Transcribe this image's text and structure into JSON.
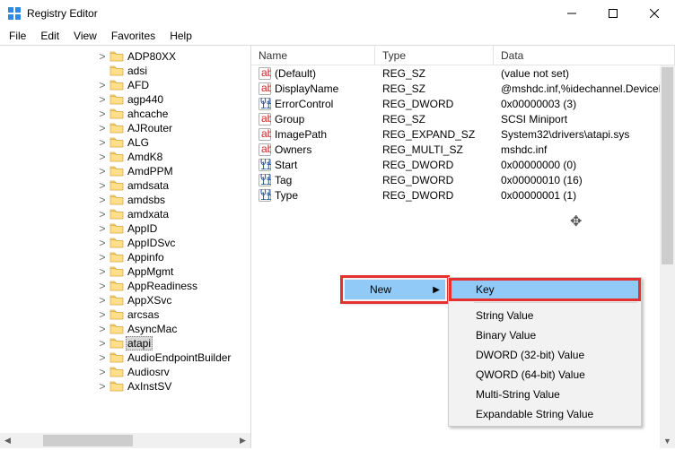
{
  "window": {
    "title": "Registry Editor"
  },
  "menu": {
    "file": "File",
    "edit": "Edit",
    "view": "View",
    "favorites": "Favorites",
    "help": "Help"
  },
  "tree": {
    "items": [
      {
        "label": "ADP80XX",
        "toggle": ">"
      },
      {
        "label": "adsi",
        "toggle": ""
      },
      {
        "label": "AFD",
        "toggle": ">"
      },
      {
        "label": "agp440",
        "toggle": ">"
      },
      {
        "label": "ahcache",
        "toggle": ">"
      },
      {
        "label": "AJRouter",
        "toggle": ">"
      },
      {
        "label": "ALG",
        "toggle": ">"
      },
      {
        "label": "AmdK8",
        "toggle": ">"
      },
      {
        "label": "AmdPPM",
        "toggle": ">"
      },
      {
        "label": "amdsata",
        "toggle": ">"
      },
      {
        "label": "amdsbs",
        "toggle": ">"
      },
      {
        "label": "amdxata",
        "toggle": ">"
      },
      {
        "label": "AppID",
        "toggle": ">"
      },
      {
        "label": "AppIDSvc",
        "toggle": ">"
      },
      {
        "label": "Appinfo",
        "toggle": ">"
      },
      {
        "label": "AppMgmt",
        "toggle": ">"
      },
      {
        "label": "AppReadiness",
        "toggle": ">"
      },
      {
        "label": "AppXSvc",
        "toggle": ">"
      },
      {
        "label": "arcsas",
        "toggle": ">"
      },
      {
        "label": "AsyncMac",
        "toggle": ">"
      },
      {
        "label": "atapi",
        "toggle": ">",
        "selected": true
      },
      {
        "label": "AudioEndpointBuilder",
        "toggle": ">"
      },
      {
        "label": "Audiosrv",
        "toggle": ">"
      },
      {
        "label": "AxInstSV",
        "toggle": ">"
      }
    ]
  },
  "columns": {
    "name": "Name",
    "type": "Type",
    "data": "Data"
  },
  "values": [
    {
      "icon": "str",
      "name": "(Default)",
      "type": "REG_SZ",
      "data": "(value not set)"
    },
    {
      "icon": "str",
      "name": "DisplayName",
      "type": "REG_SZ",
      "data": "@mshdc.inf,%idechannel.DeviceDesc%;IDE Channel"
    },
    {
      "icon": "bin",
      "name": "ErrorControl",
      "type": "REG_DWORD",
      "data": "0x00000003 (3)"
    },
    {
      "icon": "str",
      "name": "Group",
      "type": "REG_SZ",
      "data": "SCSI Miniport"
    },
    {
      "icon": "str",
      "name": "ImagePath",
      "type": "REG_EXPAND_SZ",
      "data": "System32\\drivers\\atapi.sys"
    },
    {
      "icon": "str",
      "name": "Owners",
      "type": "REG_MULTI_SZ",
      "data": "mshdc.inf"
    },
    {
      "icon": "bin",
      "name": "Start",
      "type": "REG_DWORD",
      "data": "0x00000000 (0)"
    },
    {
      "icon": "bin",
      "name": "Tag",
      "type": "REG_DWORD",
      "data": "0x00000010 (16)"
    },
    {
      "icon": "bin",
      "name": "Type",
      "type": "REG_DWORD",
      "data": "0x00000001 (1)"
    }
  ],
  "context": {
    "new": "New",
    "submenu": {
      "key": "Key",
      "string": "String Value",
      "binary": "Binary Value",
      "dword32": "DWORD (32-bit) Value",
      "qword64": "QWORD (64-bit) Value",
      "multi": "Multi-String Value",
      "expand": "Expandable String Value"
    }
  }
}
